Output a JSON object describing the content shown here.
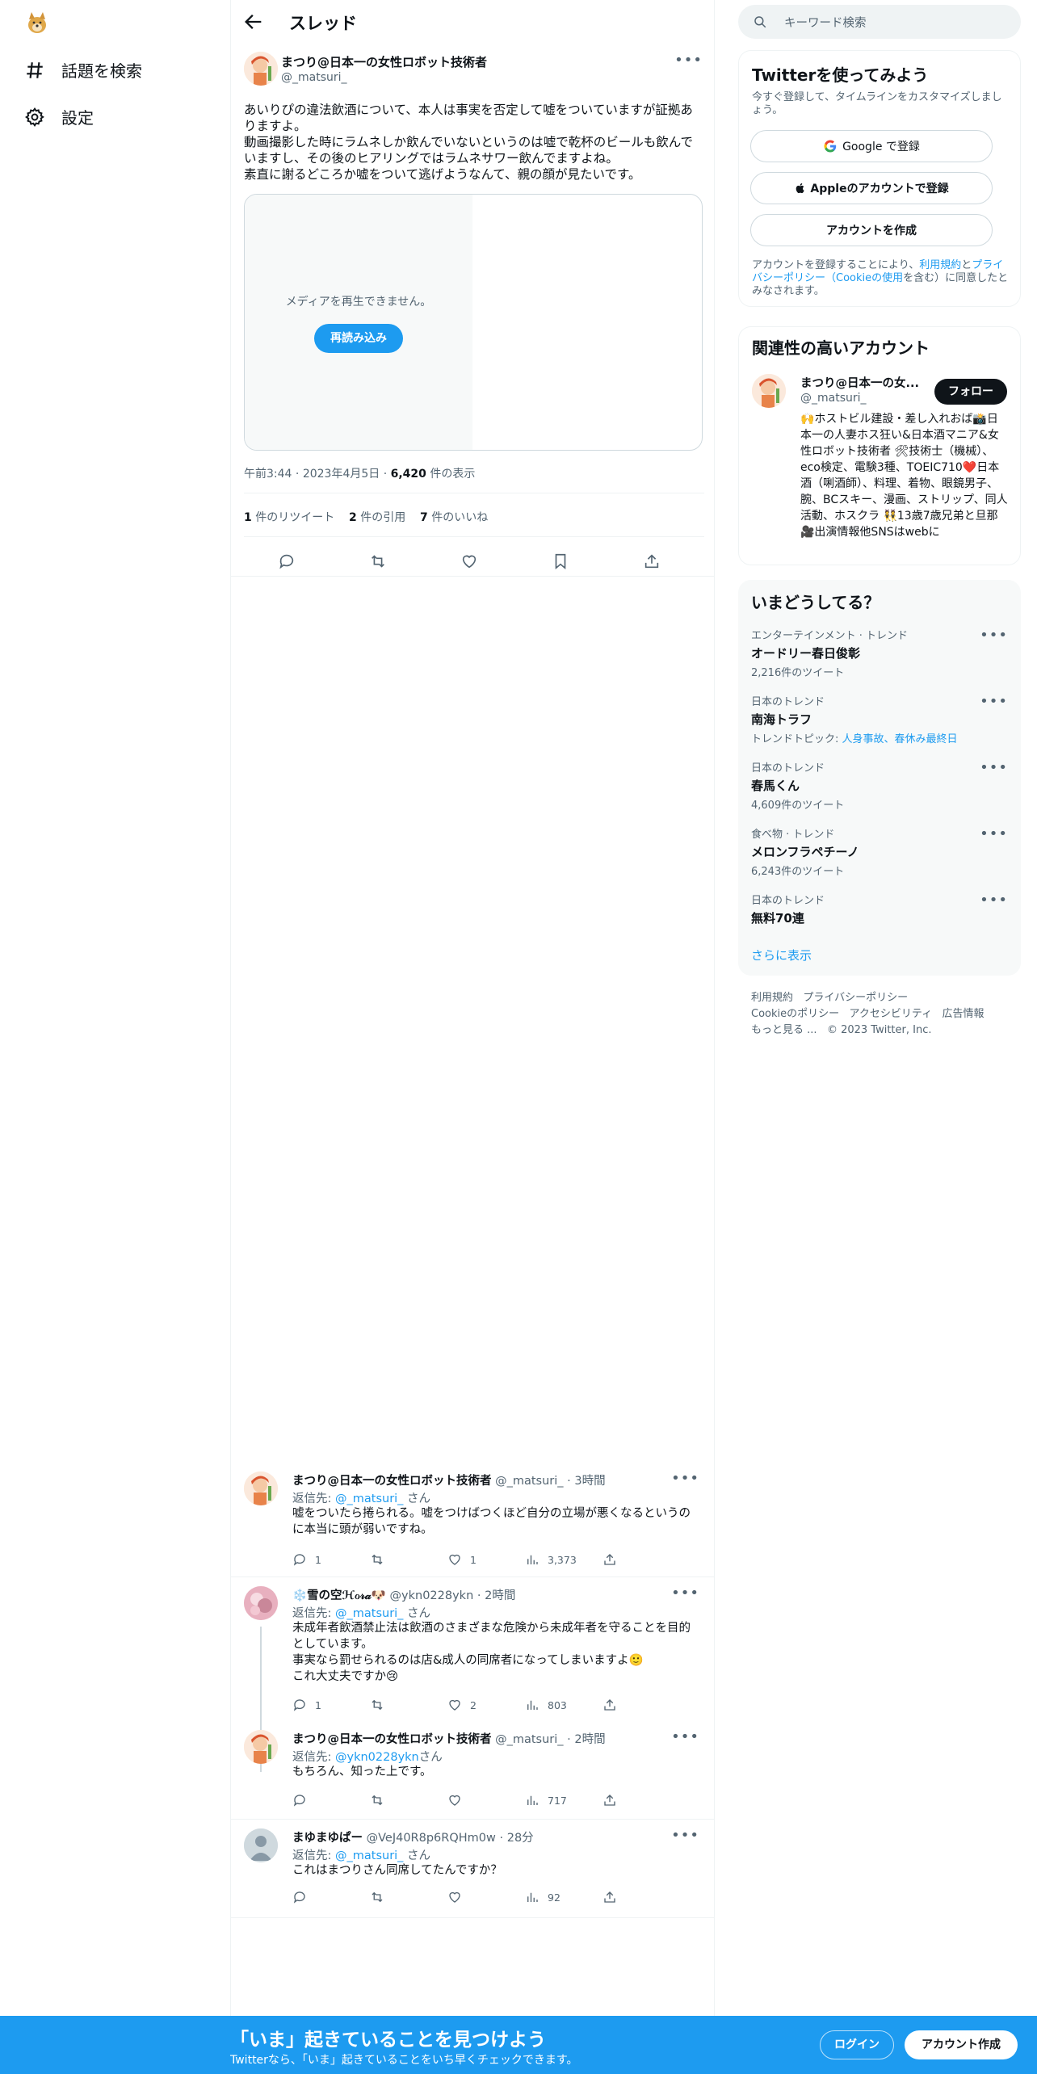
{
  "nav": {
    "explore_label": "話題を検索",
    "settings_label": "設定"
  },
  "header": {
    "title": "スレッド"
  },
  "main_tweet": {
    "name": "まつり@日本一の女性ロボット技術者",
    "handle": "@_matsuri_",
    "text": "あいりぴの違法飲酒について、本人は事実を否定して嘘をついていますが証拠ありますよ。\n動画撮影した時にラムネしか飲んでいないというのは嘘で乾杯のビールも飲んでいますし、その後のヒアリングではラムネサワー飲んでますよね。\n素直に謝るどころか嘘をついて逃げようなんて、親の顔が見たいです。",
    "media_error": "メディアを再生できません。",
    "reload_label": "再読み込み",
    "time": "午前3:44",
    "date": "2023年4月5日",
    "views_count": "6,420",
    "views_label": "件の表示",
    "retweets_count": "1",
    "retweets_label": "件のリツイート",
    "quotes_count": "2",
    "quotes_label": "件の引用",
    "likes_count": "7",
    "likes_label": "件のいいね"
  },
  "replies": [
    {
      "name": "まつり@日本一の女性ロボット技術者",
      "handle": "@_matsuri_",
      "time": "· 3時間",
      "reply_to_prefix": "返信先:",
      "reply_to": "@_matsuri_",
      "reply_to_suffix": "さん",
      "text": "嘘をついたら捲られる。嘘をつけばつくほど自分の立場が悪くなるというのに本当に頭が弱いですね。",
      "replies": "1",
      "retweets": "",
      "likes": "1",
      "views": "3,373"
    },
    {
      "name": "❄️雪の空ℋℴ𝓇𝒶🐶",
      "handle": "@ykn0228ykn",
      "time": "· 2時間",
      "reply_to_prefix": "返信先:",
      "reply_to": "@_matsuri_",
      "reply_to_suffix": "さん",
      "text": "未成年者飲酒禁止法は飲酒のさまざまな危険から未成年者を守ることを目的としています。\n事実なら罰せられるのは店&成人の同席者になってしまいますよ🙂\nこれ大丈夫ですか😢",
      "replies": "1",
      "retweets": "",
      "likes": "2",
      "views": "803"
    },
    {
      "name": "まつり@日本一の女性ロボット技術者",
      "handle": "@_matsuri_",
      "time": "· 2時間",
      "reply_to_prefix": "返信先:",
      "reply_to": "@ykn0228ykn",
      "reply_to_suffix": "さん",
      "text": "もちろん、知った上です。",
      "replies": "",
      "retweets": "",
      "likes": "",
      "views": "717"
    },
    {
      "name": "まゆまゆぱー",
      "handle": "@VeJ40R8p6RQHm0w",
      "time": "· 28分",
      "reply_to_prefix": "返信先:",
      "reply_to": "@_matsuri_",
      "reply_to_suffix": "さん",
      "text": "これはまつりさん同席してたんですか？",
      "replies": "",
      "retweets": "",
      "likes": "",
      "views": "92"
    }
  ],
  "right": {
    "search_placeholder": "キーワード検索",
    "signup_card": {
      "title": "Twitterを使ってみよう",
      "subtitle": "今すぐ登録して、タイムラインをカスタマイズしましょう。",
      "google_label": "Google で登録",
      "apple_label": "Appleのアカウントで登録",
      "create_label": "アカウントを作成",
      "legal_prefix": "アカウントを登録することにより、",
      "legal_terms": "利用規約",
      "legal_and": "と",
      "legal_privacy": "プライバシーポリシー（Cookieの使用",
      "legal_suffix": "を含む）に同意したとみなされます。"
    },
    "relevant": {
      "title": "関連性の高いアカウント",
      "name": "まつり@日本一の女...",
      "handle": "@_matsuri_",
      "follow_label": "フォロー",
      "bio": "🙌ホストビル建設・差し入れおば📸日本一の人妻ホス狂い&日本酒マニア&女性ロボット技術者 🛠技術士（機械）、eco検定、電験3種、TOEIC710❤️日本酒（唎酒師）、料理、着物、眼鏡男子、腕、BCスキー、漫画、ストリップ、同人活動、ホスクラ 👯13歳7歳兄弟と旦那 🎥出演情報他SNSはwebに"
    },
    "trends": {
      "title": "いまどうしてる？",
      "items": [
        {
          "category": "エンターテインメント · トレンド",
          "title": "オードリー春日俊彰",
          "count": "2,216件のツイート",
          "topic_prefix": "",
          "topic_links": ""
        },
        {
          "category": "日本のトレンド",
          "title": "南海トラフ",
          "count": "",
          "topic_prefix": "トレンドトピック: ",
          "topic_links": "人身事故、春休み最終日"
        },
        {
          "category": "日本のトレンド",
          "title": "春馬くん",
          "count": "4,609件のツイート",
          "topic_prefix": "",
          "topic_links": ""
        },
        {
          "category": "食べ物 · トレンド",
          "title": "メロンフラペチーノ",
          "count": "6,243件のツイート",
          "topic_prefix": "",
          "topic_links": ""
        },
        {
          "category": "日本のトレンド",
          "title": "無料70連",
          "count": "",
          "topic_prefix": "",
          "topic_links": ""
        }
      ],
      "show_more": "さらに表示"
    },
    "footer": {
      "terms": "利用規約",
      "privacy": "プライバシーポリシー",
      "cookie": "Cookieのポリシー",
      "accessibility": "アクセシビリティ",
      "ads": "広告情報",
      "more": "もっと見る ...",
      "copyright": "© 2023 Twitter, Inc."
    }
  },
  "bottom_bar": {
    "title": "「いま」起きていることを見つけよう",
    "subtitle": "Twitterなら、「いま」起きていることをいち早くチェックできます。",
    "login_label": "ログイン",
    "signup_label": "アカウント作成"
  },
  "colors": {
    "accent": "#1d9bf0",
    "text": "#0f1419",
    "muted": "#536471",
    "panel": "#f7f9f9"
  }
}
